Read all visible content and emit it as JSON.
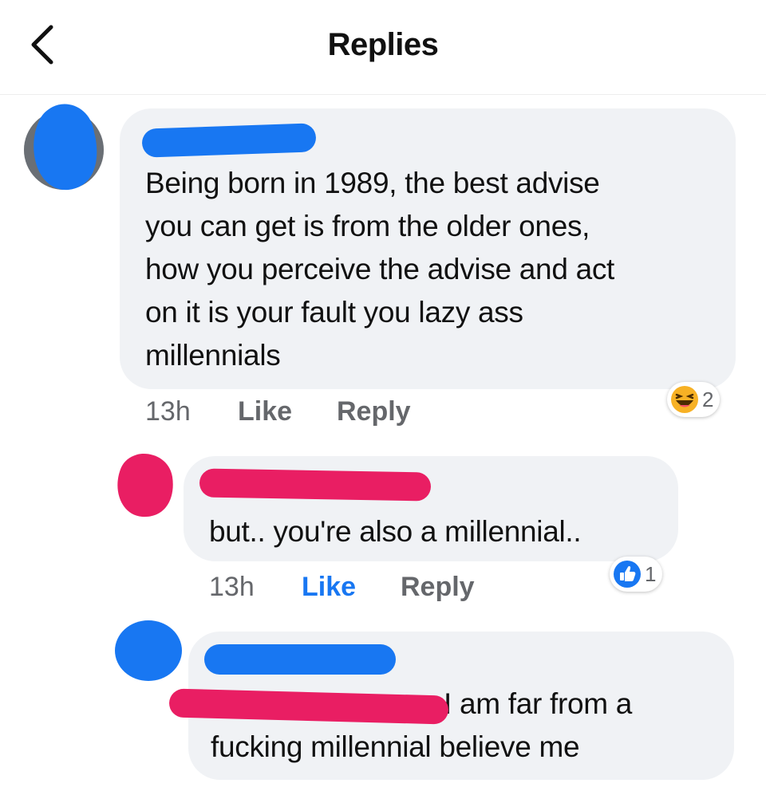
{
  "header": {
    "title": "Replies",
    "back_icon": "chevron-left-icon"
  },
  "comments": [
    {
      "text": "Being born in 1989, the best advise\nyou can get is from the older ones,\nhow you perceive the advise and act\non it is your fault you lazy ass\nmillennials",
      "time": "13h",
      "like_label": "Like",
      "reply_label": "Reply",
      "reaction": {
        "icon": "haha-emoji-icon",
        "count": "2"
      },
      "redaction_color": "#1877f2"
    },
    {
      "text": "but.. you're also a millennial..",
      "time": "13h",
      "like_label": "Like",
      "reply_label": "Reply",
      "liked": true,
      "reaction": {
        "icon": "thumbs-up-icon",
        "count": "1"
      },
      "redaction_color": "#e91e63"
    },
    {
      "text": "I am far from a\nfucking millennial believe me",
      "redaction_color": "#1877f2",
      "mention_redaction_color": "#e91e63"
    }
  ],
  "colors": {
    "bubble": "#f0f2f5",
    "meta_text": "#65676b",
    "link_blue": "#1877f2"
  }
}
